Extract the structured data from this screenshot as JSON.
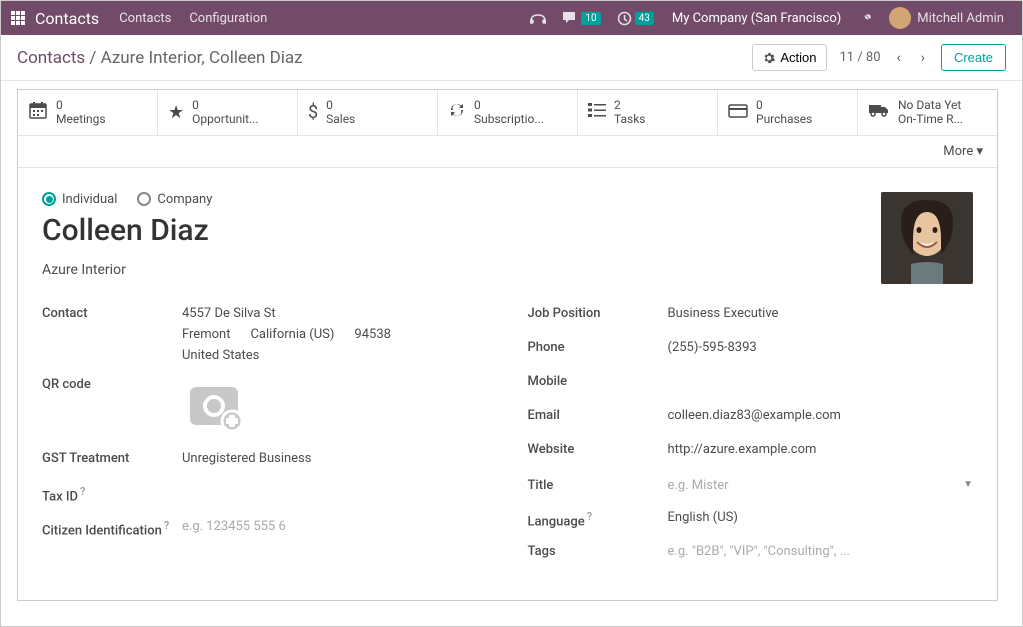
{
  "topbar": {
    "brand": "Contacts",
    "nav": [
      "Contacts",
      "Configuration"
    ],
    "msg_count": "10",
    "activity_count": "43",
    "company": "My Company (San Francisco)",
    "user": "Mitchell Admin"
  },
  "breadcrumb": {
    "root": "Contacts",
    "current": "Azure Interior, Colleen Diaz"
  },
  "toolbar": {
    "action": "Action",
    "pager": "11 / 80",
    "create": "Create"
  },
  "stats": [
    {
      "value": "0",
      "label": "Meetings"
    },
    {
      "value": "0",
      "label": "Opportunit..."
    },
    {
      "value": "0",
      "label": "Sales"
    },
    {
      "value": "0",
      "label": "Subscriptio..."
    },
    {
      "value": "2",
      "label": "Tasks"
    },
    {
      "value": "0",
      "label": "Purchases"
    },
    {
      "value": "No Data Yet",
      "label": "On-Time R..."
    }
  ],
  "more": "More",
  "radio": {
    "individual": "Individual",
    "company": "Company"
  },
  "contact": {
    "name": "Colleen Diaz",
    "company": "Azure Interior"
  },
  "labels": {
    "contact": "Contact",
    "qr": "QR code",
    "gst": "GST Treatment",
    "tax": "Tax ID",
    "citizen": "Citizen Identification",
    "job": "Job Position",
    "phone": "Phone",
    "mobile": "Mobile",
    "email": "Email",
    "website": "Website",
    "title": "Title",
    "language": "Language",
    "tags": "Tags"
  },
  "values": {
    "street": "4557 De Silva St",
    "city": "Fremont",
    "state": "California (US)",
    "zip": "94538",
    "country": "United States",
    "gst": "Unregistered Business",
    "citizen_ph": "e.g. 123455 555 6",
    "job": "Business Executive",
    "phone": "(255)-595-8393",
    "email": "colleen.diaz83@example.com",
    "website": "http://azure.example.com",
    "title_ph": "e.g. Mister",
    "language": "English (US)",
    "tags_ph": "e.g. \"B2B\", \"VIP\", \"Consulting\", ..."
  }
}
